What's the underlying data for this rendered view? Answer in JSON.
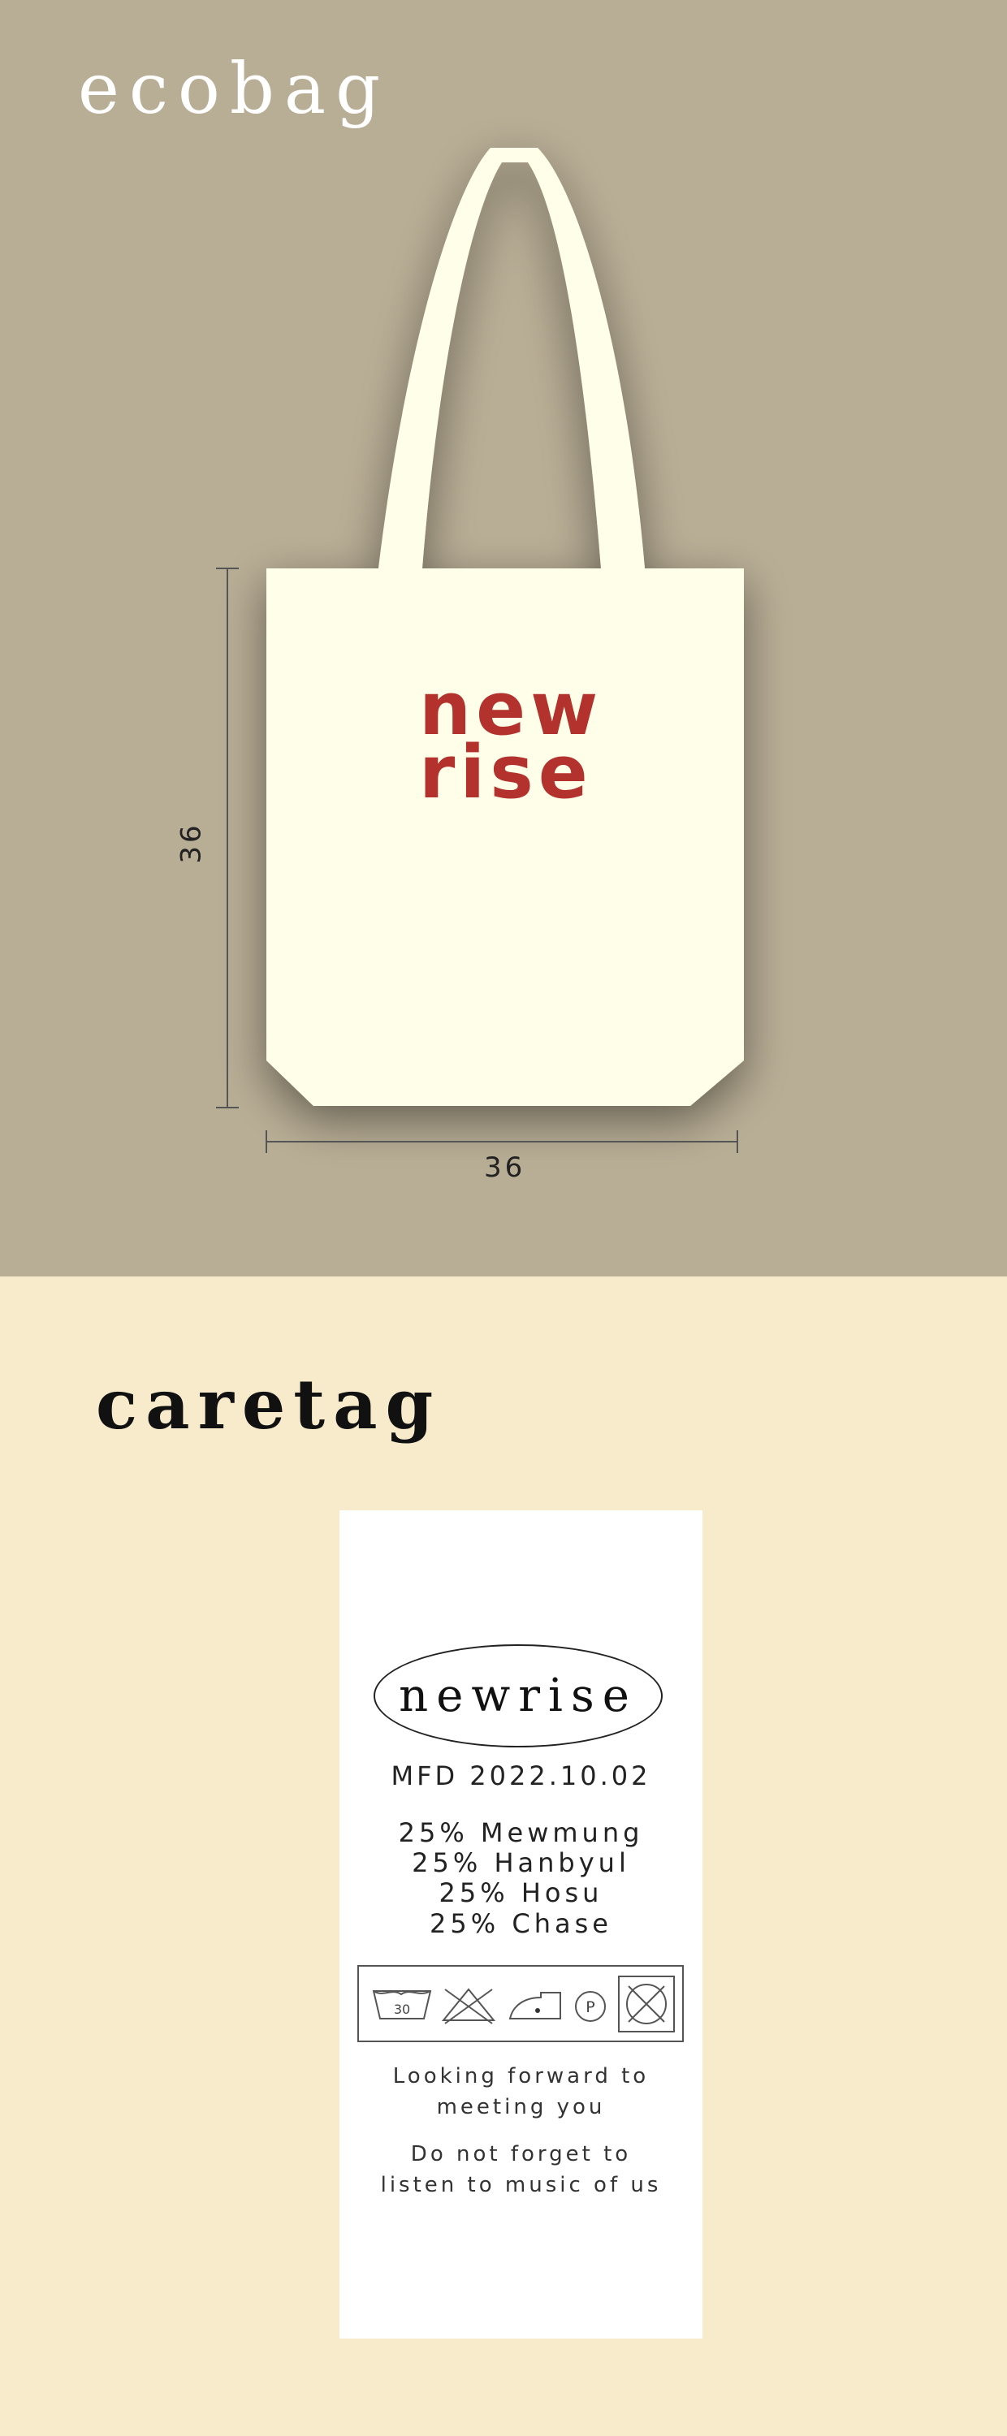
{
  "ecobag_section": {
    "title": "ecobag",
    "background_color": "#b8ad95",
    "bag_color": "#fffee8",
    "logo_color": "#b3322e",
    "logo_lines": [
      "new",
      "rise"
    ],
    "height_label": "36",
    "width_label": "36"
  },
  "caretag_section": {
    "title": "caretag",
    "background_color": "#f8ebcb",
    "tag": {
      "brand": "newrise",
      "mfd": "MFD 2022.10.02",
      "composition": [
        "25% Mewmung",
        "25% Hanbyul",
        "25% Hosu",
        "25% Chase"
      ],
      "care_icons": [
        "wash-30-icon",
        "no-bleach-icon",
        "iron-low-icon",
        "dry-clean-p-icon",
        "no-tumble-dry-icon"
      ],
      "wash_temp": "30",
      "dry_clean_letter": "P",
      "message_1": [
        "Looking forward to",
        "meeting you"
      ],
      "message_2": [
        "Do not forget to",
        "listen to music of us"
      ]
    }
  }
}
